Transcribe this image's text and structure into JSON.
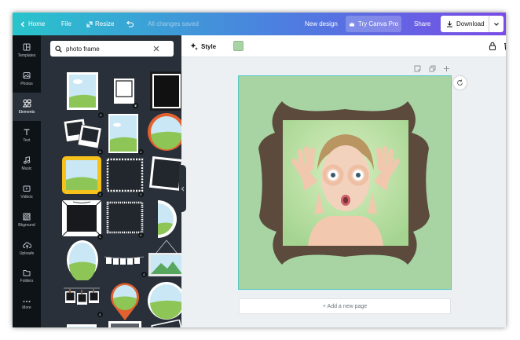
{
  "topbar": {
    "home": "Home",
    "file": "File",
    "resize": "Resize",
    "saved_status": "All changes saved",
    "new_design": "New design",
    "try_pro": "Try Canva Pro",
    "share": "Share",
    "download": "Download"
  },
  "rail": [
    {
      "label": "Templates",
      "icon": "templates-icon"
    },
    {
      "label": "Photos",
      "icon": "photos-icon"
    },
    {
      "label": "Elements",
      "icon": "elements-icon",
      "active": true
    },
    {
      "label": "Text",
      "icon": "text-icon"
    },
    {
      "label": "Music",
      "icon": "music-icon"
    },
    {
      "label": "Videos",
      "icon": "videos-icon"
    },
    {
      "label": "Bkground",
      "icon": "background-icon"
    },
    {
      "label": "Uploads",
      "icon": "uploads-icon"
    },
    {
      "label": "Folders",
      "icon": "folders-icon"
    },
    {
      "label": "More",
      "icon": "more-icon"
    }
  ],
  "search": {
    "value": "photo frame"
  },
  "toolbar": {
    "style_label": "Style",
    "swatch_color": "#a8d4a4"
  },
  "canvas": {
    "background_color": "#a8d4a4",
    "frame_color": "#5c4a3d",
    "add_page": "+ Add a new page"
  },
  "colors": {
    "accent_teal": "#28c4cc",
    "accent_purple": "#7a4be6",
    "panel_bg": "#293039",
    "rail_bg": "#0e1318"
  }
}
